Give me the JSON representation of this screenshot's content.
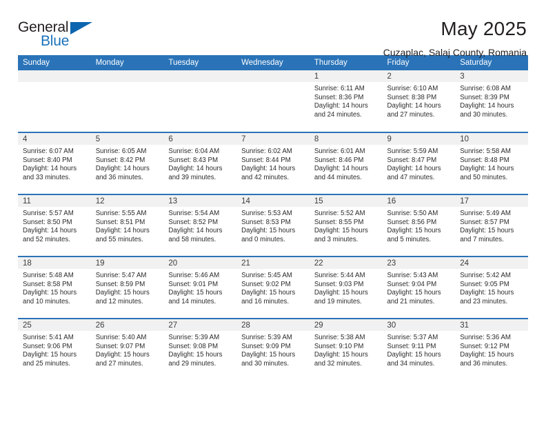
{
  "logo": {
    "text_primary": "General",
    "text_secondary": "Blue",
    "flag_icon": "blue-triangle-flag-icon",
    "color_primary": "#231f20",
    "color_secondary": "#1a72ba"
  },
  "header": {
    "title": "May 2025",
    "subtitle": "Cuzaplac, Salaj County, Romania"
  },
  "theme": {
    "header_blue": "#2a73b8",
    "band_gray": "#f1f1f1",
    "text_dark": "#231f20"
  },
  "weekday_headers": [
    "Sunday",
    "Monday",
    "Tuesday",
    "Wednesday",
    "Thursday",
    "Friday",
    "Saturday"
  ],
  "weeks": [
    [
      {
        "day": "",
        "lines": []
      },
      {
        "day": "",
        "lines": []
      },
      {
        "day": "",
        "lines": []
      },
      {
        "day": "",
        "lines": []
      },
      {
        "day": "1",
        "lines": [
          "Sunrise: 6:11 AM",
          "Sunset: 8:36 PM",
          "Daylight: 14 hours",
          "and 24 minutes."
        ]
      },
      {
        "day": "2",
        "lines": [
          "Sunrise: 6:10 AM",
          "Sunset: 8:38 PM",
          "Daylight: 14 hours",
          "and 27 minutes."
        ]
      },
      {
        "day": "3",
        "lines": [
          "Sunrise: 6:08 AM",
          "Sunset: 8:39 PM",
          "Daylight: 14 hours",
          "and 30 minutes."
        ]
      }
    ],
    [
      {
        "day": "4",
        "lines": [
          "Sunrise: 6:07 AM",
          "Sunset: 8:40 PM",
          "Daylight: 14 hours",
          "and 33 minutes."
        ]
      },
      {
        "day": "5",
        "lines": [
          "Sunrise: 6:05 AM",
          "Sunset: 8:42 PM",
          "Daylight: 14 hours",
          "and 36 minutes."
        ]
      },
      {
        "day": "6",
        "lines": [
          "Sunrise: 6:04 AM",
          "Sunset: 8:43 PM",
          "Daylight: 14 hours",
          "and 39 minutes."
        ]
      },
      {
        "day": "7",
        "lines": [
          "Sunrise: 6:02 AM",
          "Sunset: 8:44 PM",
          "Daylight: 14 hours",
          "and 42 minutes."
        ]
      },
      {
        "day": "8",
        "lines": [
          "Sunrise: 6:01 AM",
          "Sunset: 8:46 PM",
          "Daylight: 14 hours",
          "and 44 minutes."
        ]
      },
      {
        "day": "9",
        "lines": [
          "Sunrise: 5:59 AM",
          "Sunset: 8:47 PM",
          "Daylight: 14 hours",
          "and 47 minutes."
        ]
      },
      {
        "day": "10",
        "lines": [
          "Sunrise: 5:58 AM",
          "Sunset: 8:48 PM",
          "Daylight: 14 hours",
          "and 50 minutes."
        ]
      }
    ],
    [
      {
        "day": "11",
        "lines": [
          "Sunrise: 5:57 AM",
          "Sunset: 8:50 PM",
          "Daylight: 14 hours",
          "and 52 minutes."
        ]
      },
      {
        "day": "12",
        "lines": [
          "Sunrise: 5:55 AM",
          "Sunset: 8:51 PM",
          "Daylight: 14 hours",
          "and 55 minutes."
        ]
      },
      {
        "day": "13",
        "lines": [
          "Sunrise: 5:54 AM",
          "Sunset: 8:52 PM",
          "Daylight: 14 hours",
          "and 58 minutes."
        ]
      },
      {
        "day": "14",
        "lines": [
          "Sunrise: 5:53 AM",
          "Sunset: 8:53 PM",
          "Daylight: 15 hours",
          "and 0 minutes."
        ]
      },
      {
        "day": "15",
        "lines": [
          "Sunrise: 5:52 AM",
          "Sunset: 8:55 PM",
          "Daylight: 15 hours",
          "and 3 minutes."
        ]
      },
      {
        "day": "16",
        "lines": [
          "Sunrise: 5:50 AM",
          "Sunset: 8:56 PM",
          "Daylight: 15 hours",
          "and 5 minutes."
        ]
      },
      {
        "day": "17",
        "lines": [
          "Sunrise: 5:49 AM",
          "Sunset: 8:57 PM",
          "Daylight: 15 hours",
          "and 7 minutes."
        ]
      }
    ],
    [
      {
        "day": "18",
        "lines": [
          "Sunrise: 5:48 AM",
          "Sunset: 8:58 PM",
          "Daylight: 15 hours",
          "and 10 minutes."
        ]
      },
      {
        "day": "19",
        "lines": [
          "Sunrise: 5:47 AM",
          "Sunset: 8:59 PM",
          "Daylight: 15 hours",
          "and 12 minutes."
        ]
      },
      {
        "day": "20",
        "lines": [
          "Sunrise: 5:46 AM",
          "Sunset: 9:01 PM",
          "Daylight: 15 hours",
          "and 14 minutes."
        ]
      },
      {
        "day": "21",
        "lines": [
          "Sunrise: 5:45 AM",
          "Sunset: 9:02 PM",
          "Daylight: 15 hours",
          "and 16 minutes."
        ]
      },
      {
        "day": "22",
        "lines": [
          "Sunrise: 5:44 AM",
          "Sunset: 9:03 PM",
          "Daylight: 15 hours",
          "and 19 minutes."
        ]
      },
      {
        "day": "23",
        "lines": [
          "Sunrise: 5:43 AM",
          "Sunset: 9:04 PM",
          "Daylight: 15 hours",
          "and 21 minutes."
        ]
      },
      {
        "day": "24",
        "lines": [
          "Sunrise: 5:42 AM",
          "Sunset: 9:05 PM",
          "Daylight: 15 hours",
          "and 23 minutes."
        ]
      }
    ],
    [
      {
        "day": "25",
        "lines": [
          "Sunrise: 5:41 AM",
          "Sunset: 9:06 PM",
          "Daylight: 15 hours",
          "and 25 minutes."
        ]
      },
      {
        "day": "26",
        "lines": [
          "Sunrise: 5:40 AM",
          "Sunset: 9:07 PM",
          "Daylight: 15 hours",
          "and 27 minutes."
        ]
      },
      {
        "day": "27",
        "lines": [
          "Sunrise: 5:39 AM",
          "Sunset: 9:08 PM",
          "Daylight: 15 hours",
          "and 29 minutes."
        ]
      },
      {
        "day": "28",
        "lines": [
          "Sunrise: 5:39 AM",
          "Sunset: 9:09 PM",
          "Daylight: 15 hours",
          "and 30 minutes."
        ]
      },
      {
        "day": "29",
        "lines": [
          "Sunrise: 5:38 AM",
          "Sunset: 9:10 PM",
          "Daylight: 15 hours",
          "and 32 minutes."
        ]
      },
      {
        "day": "30",
        "lines": [
          "Sunrise: 5:37 AM",
          "Sunset: 9:11 PM",
          "Daylight: 15 hours",
          "and 34 minutes."
        ]
      },
      {
        "day": "31",
        "lines": [
          "Sunrise: 5:36 AM",
          "Sunset: 9:12 PM",
          "Daylight: 15 hours",
          "and 36 minutes."
        ]
      }
    ]
  ]
}
